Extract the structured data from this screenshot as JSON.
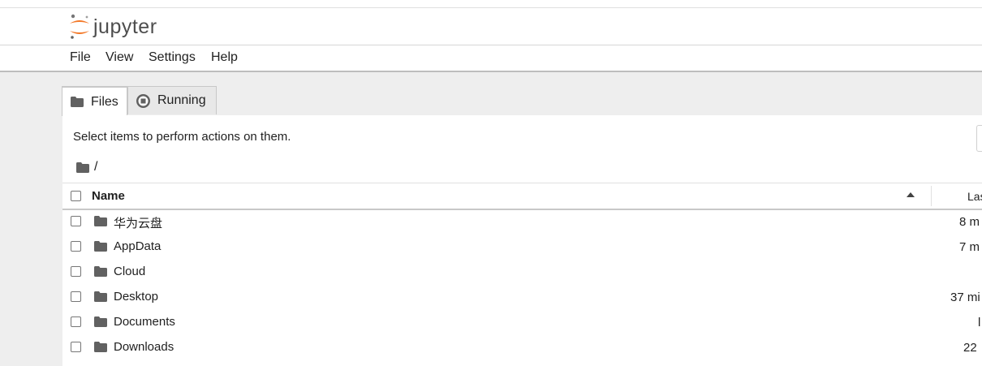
{
  "app": {
    "logo_text": "jupyter"
  },
  "menu": [
    "File",
    "View",
    "Settings",
    "Help"
  ],
  "tabs": [
    {
      "label": "Files",
      "icon": "folder-icon",
      "active": true
    },
    {
      "label": "Running",
      "icon": "stop-circle-icon",
      "active": false
    }
  ],
  "files_panel": {
    "hint": "Select items to perform actions on them.",
    "breadcrumb": "/",
    "columns": {
      "name": "Name",
      "modified": "Las"
    },
    "rows": [
      {
        "name": "华为云盘",
        "modified": "8 m"
      },
      {
        "name": "AppData",
        "modified": "7 m"
      },
      {
        "name": "Cloud",
        "modified": ""
      },
      {
        "name": "Desktop",
        "modified": "37 mi"
      },
      {
        "name": "Documents",
        "modified": "l"
      },
      {
        "name": "Downloads",
        "modified": "22"
      }
    ]
  },
  "colors": {
    "logo_orange": "#f37726",
    "workspace_bg": "#eeeeee",
    "icon_gray": "#616161"
  }
}
